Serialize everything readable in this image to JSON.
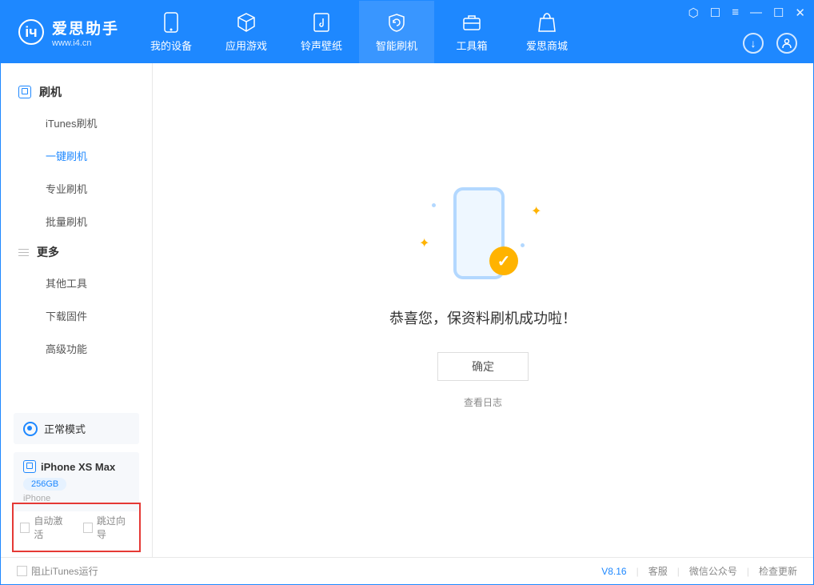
{
  "app": {
    "title": "爱思助手",
    "subtitle": "www.i4.cn"
  },
  "tabs": {
    "device": "我的设备",
    "apps": "应用游戏",
    "ring": "铃声壁纸",
    "flash": "智能刷机",
    "tools": "工具箱",
    "store": "爱思商城"
  },
  "sidebar": {
    "group1": "刷机",
    "items1": {
      "a": "iTunes刷机",
      "b": "一键刷机",
      "c": "专业刷机",
      "d": "批量刷机"
    },
    "group2": "更多",
    "items2": {
      "a": "其他工具",
      "b": "下载固件",
      "c": "高级功能"
    }
  },
  "mode": {
    "label": "正常模式"
  },
  "device": {
    "name": "iPhone XS Max",
    "storage": "256GB",
    "type": "iPhone"
  },
  "options": {
    "auto_activate": "自动激活",
    "skip_guide": "跳过向导"
  },
  "main": {
    "success": "恭喜您，保资料刷机成功啦！",
    "ok": "确定",
    "view_log": "查看日志"
  },
  "footer": {
    "block_itunes": "阻止iTunes运行",
    "version": "V8.16",
    "support": "客服",
    "wechat": "微信公众号",
    "update": "检查更新"
  }
}
